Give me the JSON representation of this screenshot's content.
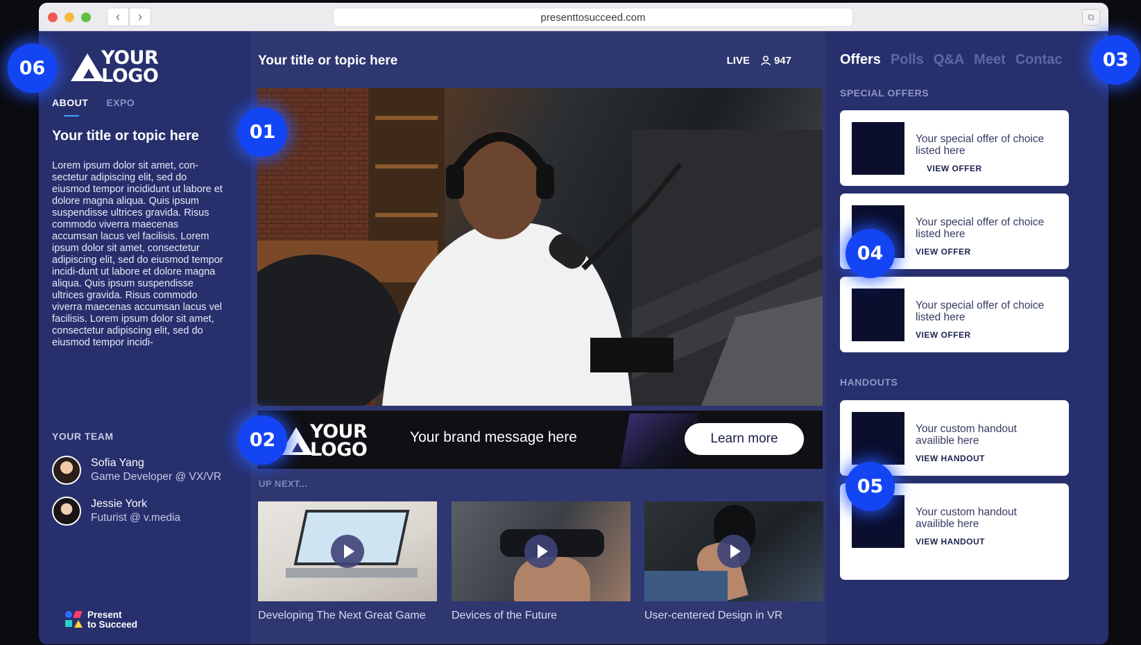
{
  "browser": {
    "url": "presenttosucceed.com",
    "back": "‹",
    "forward": "›"
  },
  "left": {
    "logo": {
      "line1": "YOUR",
      "line2": "LOGO"
    },
    "tabs": [
      {
        "label": "ABOUT"
      },
      {
        "label": "EXPO"
      }
    ],
    "title": "Your title or topic here",
    "body": "Lorem ipsum dolor sit amet, con-sectetur adipiscing elit, sed do eiusmod tempor incididunt ut labore et dolore magna aliqua. Quis ipsum suspendisse ultrices gravida. Risus commodo viverra maecenas accumsan lacus vel facilisis. Lorem ipsum dolor sit amet, consectetur adipiscing elit, sed do eiusmod tempor incidi-dunt ut labore et dolore magna aliqua. Quis ipsum suspendisse ultrices gravida. Risus commodo viverra maecenas accumsan lacus vel facilisis. Lorem ipsum dolor sit amet, consectetur adipiscing elit, sed do eiusmod tempor incidi-",
    "team_heading": "YOUR TEAM",
    "team": [
      {
        "name": "Sofia Yang",
        "role": "Game Developer @ VX/VR"
      },
      {
        "name": "Jessie York",
        "role": "Futurist @ v.media"
      }
    ],
    "footer_brand": {
      "line1": "Present",
      "line2": "to Succeed"
    }
  },
  "center": {
    "title": "Your title or topic here",
    "live_label": "LIVE",
    "viewer_count": "947",
    "banner": {
      "logo": {
        "line1": "YOUR",
        "line2": "LOGO"
      },
      "message": "Your brand message here",
      "button": "Learn more"
    },
    "upnext_label": "UP NEXT...",
    "upnext": [
      {
        "title": "Developing The Next Great Game"
      },
      {
        "title": "Devices of the Future"
      },
      {
        "title": "User-centered Design in VR"
      }
    ]
  },
  "right": {
    "tabs": [
      {
        "label": "Offers"
      },
      {
        "label": "Polls"
      },
      {
        "label": "Q&A"
      },
      {
        "label": "Meet"
      },
      {
        "label": "Contac"
      }
    ],
    "offers_heading": "SPECIAL OFFERS",
    "offers": [
      {
        "text": "Your special offer of choice listed here",
        "cta": "VIEW OFFER"
      },
      {
        "text": "Your special offer of choice listed here",
        "cta": "VIEW OFFER"
      },
      {
        "text": "Your special offer of choice listed here",
        "cta": "VIEW OFFER"
      }
    ],
    "handouts_heading": "HANDOUTS",
    "handouts": [
      {
        "text": "Your custom handout availible here",
        "cta": "VIEW HANDOUT"
      },
      {
        "text": "Your custom handout availible here",
        "cta": "VIEW HANDOUT"
      }
    ]
  },
  "callouts": [
    "01",
    "02",
    "03",
    "04",
    "05",
    "06"
  ],
  "colors": {
    "accent": "#1445f5",
    "panel": "#27306d",
    "center": "#2e3770",
    "banner": "#0f0f14"
  }
}
